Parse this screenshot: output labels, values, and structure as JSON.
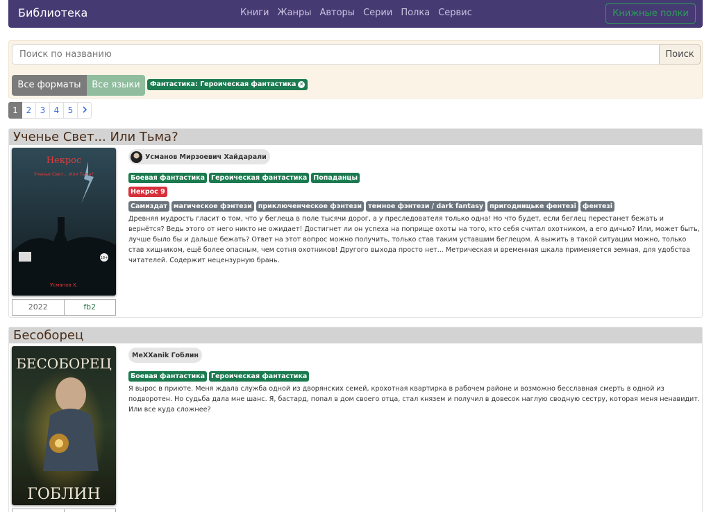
{
  "navbar": {
    "brand": "Библиотека",
    "links": [
      "Книги",
      "Жанры",
      "Авторы",
      "Серии",
      "Полка",
      "Сервис"
    ],
    "shelves_button": "Книжные полки"
  },
  "search": {
    "placeholder": "Поиск по названию",
    "button": "Поиск"
  },
  "filters": {
    "formats": "Все форматы",
    "languages": "Все языки",
    "active_genre": "Фантастика: Героическая фантастика",
    "remove_icon": "x-circle-icon"
  },
  "pagination": {
    "pages": [
      "1",
      "2",
      "3",
      "4",
      "5"
    ],
    "current": 1,
    "next_icon": "chevron-right-icon"
  },
  "books": [
    {
      "title": "Ученье Свет... Или Тьма?",
      "cover": {
        "series": "Некрос",
        "title": "Ученье Свет... Или Тьма?",
        "author": "Усманов Х.",
        "age": "18+"
      },
      "year": "2022",
      "format": "fb2",
      "author": "Усманов Мирзоевич Хайдарали",
      "genres": [
        "Боевая фантастика",
        "Героическая фантастика",
        "Попаданцы"
      ],
      "series": "Некрос  9",
      "tags": [
        "Самиздат",
        "магическое фэнтези",
        "приключенческое фэнтези",
        "темное фэнтези / dark fantasy",
        "пригодницьке фентезі",
        "фентезі"
      ],
      "description": "Древняя мудрость гласит о том, что у беглеца в поле тысячи дорог, а у преследователя только одна! Но что будет, если беглец перестанет бежать и вернётся? Ведь этого от него никто не ожидает! Достигнет ли он успеха на поприще охоты на того, кто себя считал охотником, а его дичью? Или, может быть, лучше было бы и дальше бежать? Ответ на этот вопрос можно получить, только став таким уставшим беглецом. А выжить в такой ситуации можно, только став хищником, ещё более опасным, чем сотня охотников! Другого выхода просто нет... Метрическая и временная шкала применяется земная, для удобства читателей. Содержит нецензурную брань."
    },
    {
      "title": "Бесоборец",
      "cover": {
        "title": "БЕСОБОРЕЦ",
        "author": "ГОБЛИН"
      },
      "author": "MeXXanik  Гоблин",
      "genres": [
        "Боевая фантастика",
        "Героическая фантастика"
      ],
      "description": "Я вырос в приюте. Меня ждала служба одной из дворянских семей, крохотная квартирка в рабочем районе и возможно бесславная смерть в одной из подворотен. Но судьба дала мне шанс. Я, бастард, попал в дом своего отца, стал князем и получил в довесок наглую сводную сестру, которая меня ненавидит. Или все куда сложнее?"
    }
  ],
  "colors": {
    "navbar": "#463a73",
    "genre_tag": "#1b7a4f",
    "series_tag": "#d6303b",
    "tag": "#6c757d",
    "filter_panel": "#fbf3e6"
  }
}
